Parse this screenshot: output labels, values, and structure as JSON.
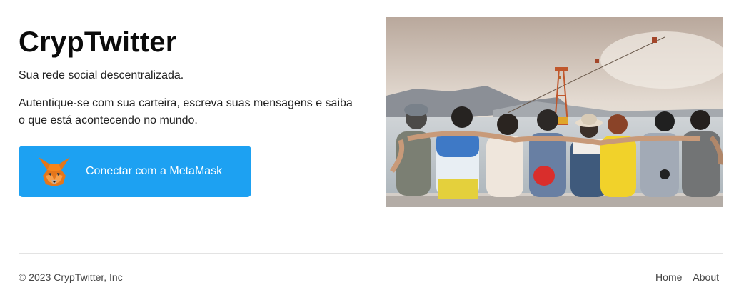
{
  "hero": {
    "title": "CrypTwitter",
    "subtitle": "Sua rede social descentralizada.",
    "description": "Autentique-se com sua carteira, escreva suas mensagens e saiba o que está acontecendo no mundo.",
    "connect_button": {
      "label": "Conectar com a MetaMask",
      "icon": "metamask-fox-icon",
      "color": "#1da1f2"
    },
    "image": {
      "icon": "friends-photo"
    }
  },
  "footer": {
    "copyright": "© 2023 CrypTwitter, Inc",
    "links": [
      {
        "label": "Home"
      },
      {
        "label": "About"
      }
    ]
  }
}
